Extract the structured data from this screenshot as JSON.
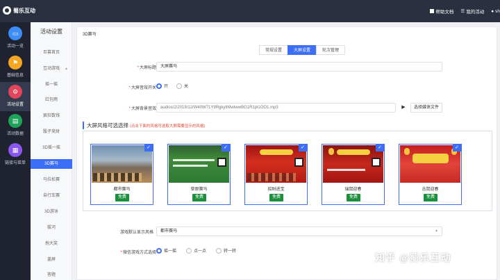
{
  "brand": {
    "name": "蜀乐互动"
  },
  "header": {
    "links": [
      {
        "label": "帮助文档",
        "icon": "doc-icon"
      },
      {
        "label": "我的活动",
        "icon": "list-icon"
      },
      {
        "label": "sh",
        "icon": "user-icon"
      }
    ]
  },
  "left_nav": [
    {
      "label": "活动一览",
      "icon": "monitor-icon",
      "color": "#3c8df6"
    },
    {
      "label": "基础信息",
      "icon": "flag-icon",
      "color": "#f5a623"
    },
    {
      "label": "活动设置",
      "icon": "gear-icon",
      "color": "#e2445c",
      "active": true
    },
    {
      "label": "活动数据",
      "icon": "chart-icon",
      "color": "#1ea35a"
    },
    {
      "label": "链接与菜单",
      "icon": "grid-icon",
      "color": "#8a56f0"
    }
  ],
  "sub_nav": {
    "title": "活动设置",
    "group_label": "互动游戏",
    "items": [
      "巨幕首页",
      "互动游戏",
      "摇一摇",
      "红包雨",
      "疯狂数钱",
      "骰子竞财",
      "3D摇一摇",
      "3D赛马",
      "马拉松赛",
      "自行车赛",
      "3D游泳",
      "拔河",
      "拖大奖",
      "盖屏",
      "答题"
    ],
    "active_index": 7
  },
  "page": {
    "breadcrumb": "3D赛马",
    "tabs": [
      {
        "label": "常规设置",
        "active": false
      },
      {
        "label": "大屏设置",
        "active": true
      },
      {
        "label": "轮次管理",
        "active": false
      }
    ],
    "form": {
      "title_label": "大屏标题",
      "title_value": "大屏赛马",
      "sound_label": "大屏音效开关",
      "sound_options": [
        "开",
        "关"
      ],
      "sound_selected": "开",
      "music_label": "大屏背景音效",
      "music_value": "audios/2/2019/12/W40W71Y9Rgkylh9wIwwBG1R1pl1OO1.mp3",
      "choose_file_label": "选择媒体文件"
    },
    "styles_section": {
      "title": "大屏风格可选选择",
      "hint": "(点击下面的风格可选取大屏需要显示的风格)",
      "styles": [
        {
          "name": "都市赛马",
          "badge": "免费",
          "theme": "city"
        },
        {
          "name": "草原赛马",
          "badge": "免费",
          "theme": "grass"
        },
        {
          "name": "招财进宝",
          "badge": "免费",
          "theme": "red"
        },
        {
          "name": "瑞鼠迎春",
          "badge": "免费",
          "theme": "red2"
        },
        {
          "name": "吉鼠迎春",
          "badge": "免费",
          "theme": "spring"
        }
      ]
    },
    "default_style": {
      "label": "游戏默认显示风格",
      "value": "都市赛马"
    },
    "play_mode": {
      "label": "微信游戏方式选择",
      "options": [
        "摇一摇",
        "点一点",
        "转一转"
      ],
      "selected": "摇一摇"
    }
  },
  "watermark": "知乎 @蜀乐互动"
}
